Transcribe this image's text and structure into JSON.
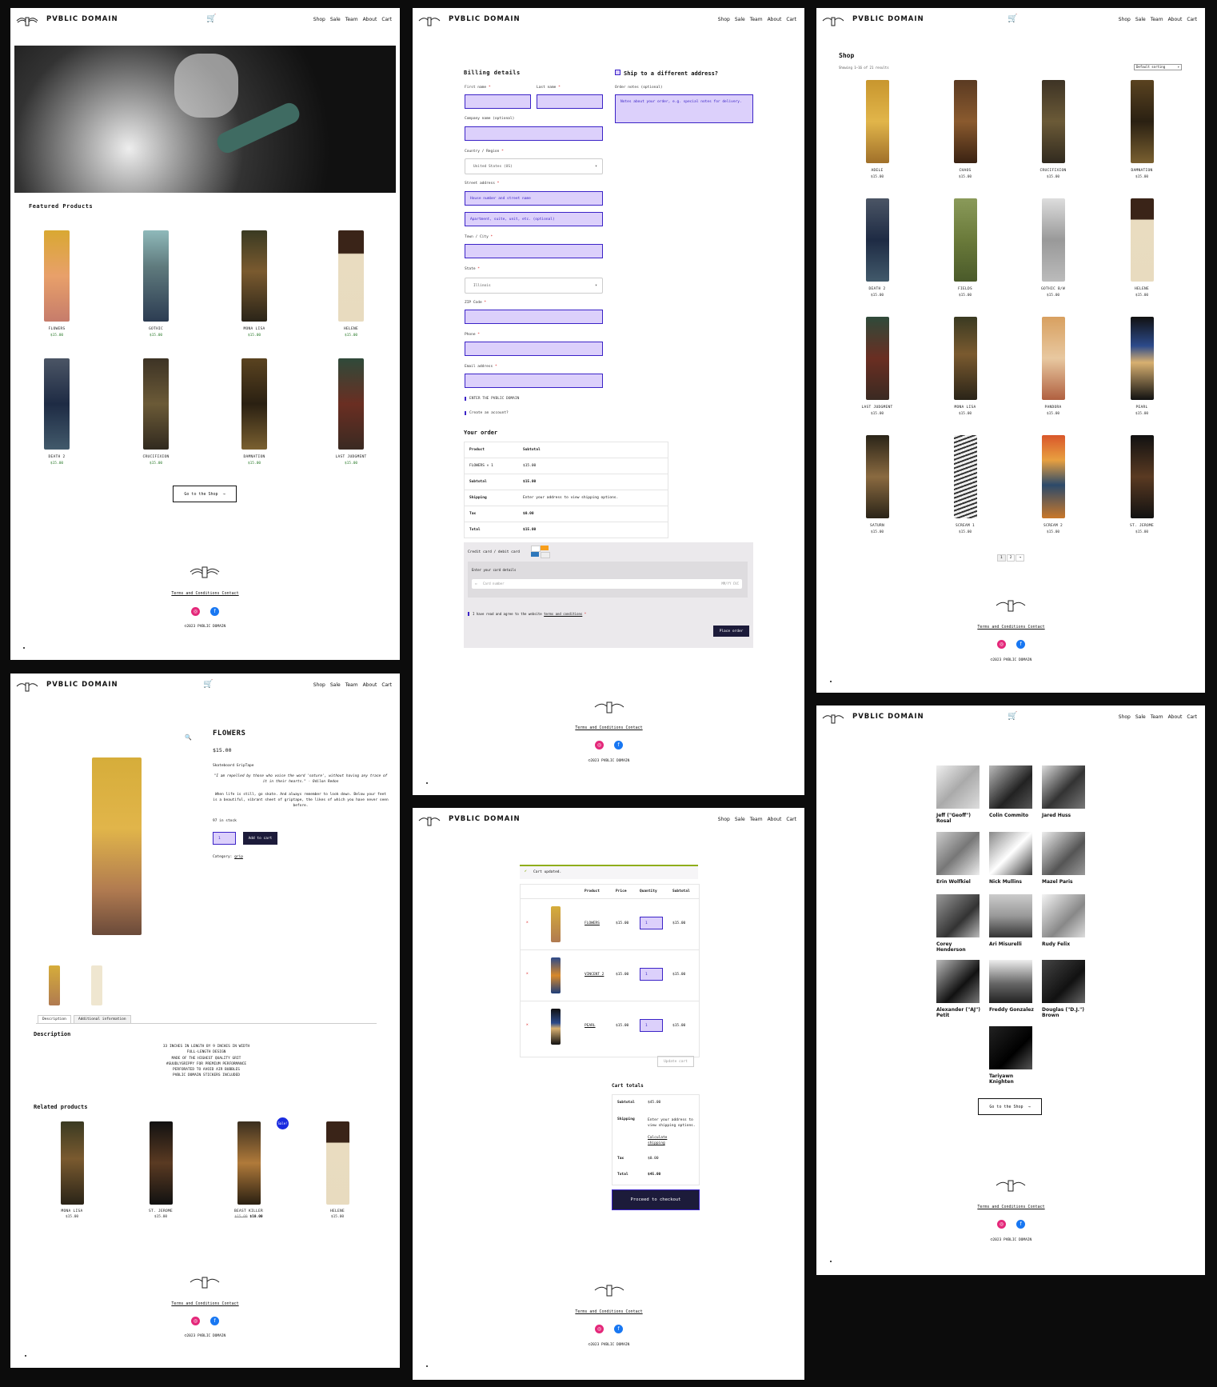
{
  "site": {
    "brand": "PVBLIC DOMAIN",
    "nav": [
      "Shop",
      "Sale",
      "Team",
      "About",
      "Cart"
    ],
    "footer_links": "Terms and Conditions Contact",
    "copyright": "©2023 PVBLIC DOMAIN"
  },
  "home": {
    "featured_title": "Featured Products",
    "products": [
      {
        "name": "FLOWERS",
        "price": "$15.00"
      },
      {
        "name": "GOTHIC",
        "price": "$15.00"
      },
      {
        "name": "MONA LISA",
        "price": "$15.00"
      },
      {
        "name": "HELENE",
        "price": "$15.00"
      },
      {
        "name": "DEATH 2",
        "price": "$15.00"
      },
      {
        "name": "CRUCIFIXION",
        "price": "$15.00"
      },
      {
        "name": "DAMNATION",
        "price": "$15.00"
      },
      {
        "name": "LAST JUDGMENT",
        "price": "$15.00"
      }
    ],
    "shop_button": "Go to the Shop"
  },
  "product": {
    "title": "FLOWERS",
    "price": "$15.00",
    "type": "Skateboard GripTape",
    "quote": "\"I am repelled by those who voice the word 'nature', without having any trace of it in their hearts.\" - Odilon Redon",
    "blurb": "When life is still, go skate. And always remember to look down. Below your feet is a beautiful, vibrant sheet of griptape, the likes of which you have never seen before.",
    "stock": "97 in stock",
    "qty": "1",
    "add_to_cart": "Add to cart",
    "category_label": "Category:",
    "category": "grip",
    "tabs": [
      "Description",
      "Additional information"
    ],
    "description_title": "Description",
    "description_lines": [
      "33 INCHES IN LENGTH BY 9 INCHES IN WIDTH",
      "FULL-LENGTH DESIGN",
      "MADE OF THE HIGHEST QUALITY GRIT",
      "#GUUDLYGRIPPY FOR PREMIUM PERFORMANCE",
      "PERFORATED TO AVOID AIR BUBBLES",
      "PVBLIC DOMAIN STICKERS INCLUDED"
    ],
    "related_title": "Related products",
    "sale_badge": "Sale!",
    "related": [
      {
        "name": "MONA LISA",
        "price": "$15.00",
        "old": ""
      },
      {
        "name": "ST. JEROME",
        "price": "$15.00",
        "old": ""
      },
      {
        "name": "BEAST KILLER",
        "price": "$10.00",
        "old": "$15.00"
      },
      {
        "name": "HELENE",
        "price": "$15.00",
        "old": ""
      }
    ]
  },
  "checkout": {
    "billing_title": "Billing details",
    "ship_diff": "Ship to a different address?",
    "order_notes_label": "Order notes (optional)",
    "order_notes_placeholder": "Notes about your order, e.g. special notes for delivery.",
    "first_name": "First name",
    "last_name": "Last name",
    "company": "Company name (optional)",
    "country_label": "Country / Region",
    "country_value": "United States (US)",
    "street_label": "Street address",
    "street_ph1": "House number and street name",
    "street_ph2": "Apartment, suite, unit, etc. (optional)",
    "city_label": "Town / City",
    "state_label": "State",
    "state_value": "Illinois",
    "zip_label": "ZIP Code",
    "phone_label": "Phone",
    "email_label": "Email address",
    "enter_check": "ENTER THE PVBLIC DOMAIN",
    "create_account": "Create an account?",
    "your_order": "Your order",
    "order_rows": [
      [
        "Product",
        "Subtotal"
      ],
      [
        "FLOWERS × 1",
        "$15.00"
      ],
      [
        "Subtotal",
        "$15.00"
      ],
      [
        "Shipping",
        "Enter your address to view shipping options."
      ],
      [
        "Tax",
        "$0.00"
      ],
      [
        "Total",
        "$15.00"
      ]
    ],
    "payment_method": "Credit card / debit card",
    "card_details": "Enter your card details",
    "card_number_ph": "Card number",
    "card_expiry_ph": "MM/YY CVC",
    "terms_text": "I have read and agree to the website",
    "terms_link": "terms and conditions",
    "place_order": "Place order"
  },
  "cart": {
    "notice": "Cart updated.",
    "headers": [
      "Product",
      "Price",
      "Quantity",
      "Subtotal"
    ],
    "items": [
      {
        "name": "FLOWERS",
        "price": "$15.00",
        "qty": "1",
        "subtotal": "$15.00"
      },
      {
        "name": "VINCENT 2",
        "price": "$15.00",
        "qty": "1",
        "subtotal": "$15.00"
      },
      {
        "name": "PEARL",
        "price": "$15.00",
        "qty": "1",
        "subtotal": "$15.00"
      }
    ],
    "update_cart": "Update cart",
    "totals_title": "Cart totals",
    "subtotal_label": "Subtotal",
    "subtotal": "$45.00",
    "shipping_label": "Shipping",
    "shipping_text": "Enter your address to view shipping options.",
    "calc_shipping": "Calculate shipping",
    "tax_label": "Tax",
    "tax": "$0.00",
    "total_label": "Total",
    "total": "$45.00",
    "checkout_button": "Proceed to checkout"
  },
  "shop": {
    "title": "Shop",
    "result_count": "Showing 1–16 of 21 results",
    "sorting": "Default sorting",
    "products": [
      {
        "name": "ADELE",
        "price": "$15.00"
      },
      {
        "name": "CHAOS",
        "price": "$15.00"
      },
      {
        "name": "CRUCIFIXION",
        "price": "$15.00"
      },
      {
        "name": "DAMNATION",
        "price": "$15.00"
      },
      {
        "name": "DEATH 2",
        "price": "$15.00"
      },
      {
        "name": "FIELDS",
        "price": "$15.00"
      },
      {
        "name": "GOTHIC B/W",
        "price": "$15.00"
      },
      {
        "name": "HELENE",
        "price": "$15.00"
      },
      {
        "name": "LAST JUDGMENT",
        "price": "$15.00"
      },
      {
        "name": "MONA LISA",
        "price": "$15.00"
      },
      {
        "name": "PANDORA",
        "price": "$15.00"
      },
      {
        "name": "PEARL",
        "price": "$15.00"
      },
      {
        "name": "SATURN",
        "price": "$15.00"
      },
      {
        "name": "SCREAM 1",
        "price": "$15.00"
      },
      {
        "name": "SCREAM 2",
        "price": "$15.00"
      },
      {
        "name": "ST. JEROME",
        "price": "$15.00"
      }
    ],
    "pages": [
      "1",
      "2",
      "→"
    ]
  },
  "team": {
    "members": [
      "Jeff (\"Geoff\") Rosal",
      "Colin Commito",
      "Jared Huss",
      "Erin Wolfkiel",
      "Nick Mullins",
      "Mazel Paris",
      "Corey Henderson",
      "Ari Misurelli",
      "Rudy Felix",
      "Alexander (\"AJ\") Petit",
      "Freddy Gonzalez",
      "Douglas (\"D.J.\") Brown",
      "Tariyawn Knighten"
    ],
    "shop_button": "Go to the Shop"
  }
}
